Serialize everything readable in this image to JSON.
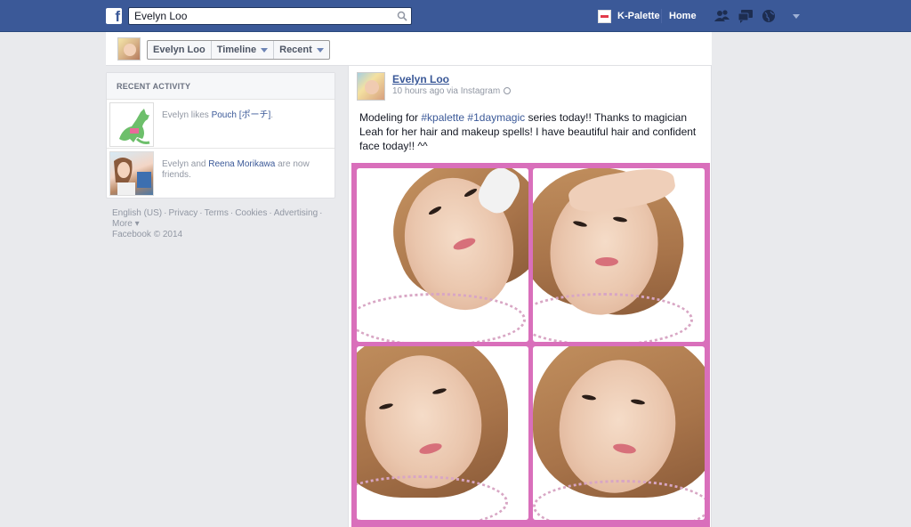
{
  "topbar": {
    "search_value": "Evelyn Loo",
    "page_link": "K-Palette",
    "home_link": "Home"
  },
  "timeline_header": {
    "name_button": "Evelyn Loo",
    "timeline_button": "Timeline",
    "recent_button": "Recent"
  },
  "recent_activity": {
    "heading": "RECENT ACTIVITY",
    "items": [
      {
        "prefix": "Evelyn likes ",
        "link": "Pouch [ポーチ]",
        "suffix": "."
      },
      {
        "prefix": "Evelyn and ",
        "link": "Reena Morikawa",
        "suffix": " are now friends."
      }
    ]
  },
  "footer": {
    "links": [
      "English (US)",
      "Privacy",
      "Terms",
      "Cookies",
      "Advertising"
    ],
    "more": "More",
    "copyright": "Facebook © 2014"
  },
  "post": {
    "author": "Evelyn Loo",
    "meta": "10 hours ago via Instagram",
    "text_1": "Modeling for ",
    "tag_1": "#kpalette",
    "tag_2": "#1daymagic",
    "text_2": " series today!! Thanks to magician Leah for her hair and makeup spells! I have beautiful hair and confident face today!! ^^"
  },
  "colors": {
    "brand_blue": "#3b5998",
    "collage_border": "#d96fbb"
  }
}
